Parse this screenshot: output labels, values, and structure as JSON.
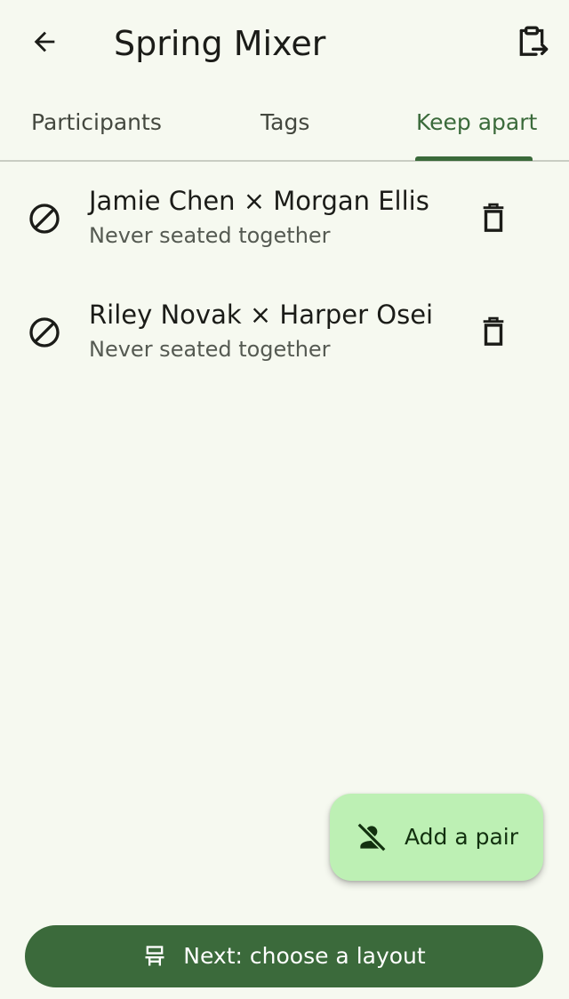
{
  "app": {
    "title": "Spring Mixer"
  },
  "toolbar": {
    "back_icon": "arrow-back-icon",
    "export_icon": "clipboard-export-icon"
  },
  "tabs": [
    {
      "label": "Participants",
      "active": false
    },
    {
      "label": "Tags",
      "active": false
    },
    {
      "label": "Keep apart",
      "active": true
    }
  ],
  "pairs": [
    {
      "names": "Jamie Chen × Morgan Ellis",
      "note": "Never seated together",
      "icon": "block-icon",
      "delete_icon": "delete-icon"
    },
    {
      "names": "Riley Novak × Harper Osei",
      "note": "Never seated together",
      "icon": "block-icon",
      "delete_icon": "delete-icon"
    }
  ],
  "fab": {
    "label": "Add a pair",
    "icon": "person-off-icon"
  },
  "next_button": {
    "label": "Next: choose a layout",
    "icon": "table-layout-icon"
  },
  "colors": {
    "accent": "#3b6a3b",
    "fab_bg": "#bdf0b4",
    "background": "#f6f9f0"
  }
}
